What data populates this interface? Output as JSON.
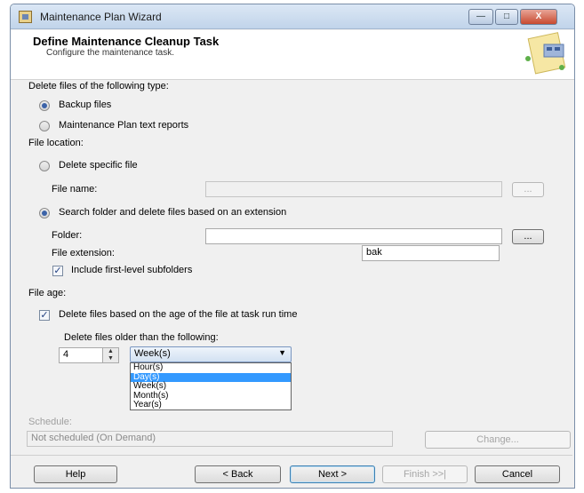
{
  "window": {
    "title": "Maintenance Plan Wizard",
    "controls": {
      "minimize": "—",
      "maximize": "□",
      "close": "X"
    }
  },
  "header": {
    "title": "Define Maintenance Cleanup Task",
    "subtitle": "Configure the maintenance task."
  },
  "delete_type": {
    "label": "Delete files of the following type:",
    "options": [
      {
        "label": "Backup files",
        "selected": true
      },
      {
        "label": "Maintenance Plan text reports",
        "selected": false
      }
    ]
  },
  "file_location": {
    "label": "File location:",
    "specific_file_option": "Delete specific file",
    "file_name_label": "File name:",
    "file_name_value": "",
    "browse_label": "...",
    "search_option": "Search folder and delete files based on an extension",
    "folder_label": "Folder:",
    "folder_value": "",
    "extension_label": "File extension:",
    "extension_value": "bak",
    "subfolders_label": "Include first-level subfolders",
    "subfolders_checked": true
  },
  "file_age": {
    "label": "File age:",
    "delete_by_age_label": "Delete files based on the age of the file at task run time",
    "delete_by_age_checked": true,
    "older_than_label": "Delete files older than the following:",
    "amount": "4",
    "unit_selected": "Week(s)",
    "unit_options": [
      "Hour(s)",
      "Day(s)",
      "Week(s)",
      "Month(s)",
      "Year(s)"
    ],
    "highlighted_option": "Day(s)"
  },
  "schedule": {
    "label": "Schedule:",
    "value": "Not scheduled (On Demand)",
    "change_label": "Change..."
  },
  "footer": {
    "help": "Help",
    "back": "< Back",
    "next": "Next >",
    "finish": "Finish >>|",
    "cancel": "Cancel"
  }
}
